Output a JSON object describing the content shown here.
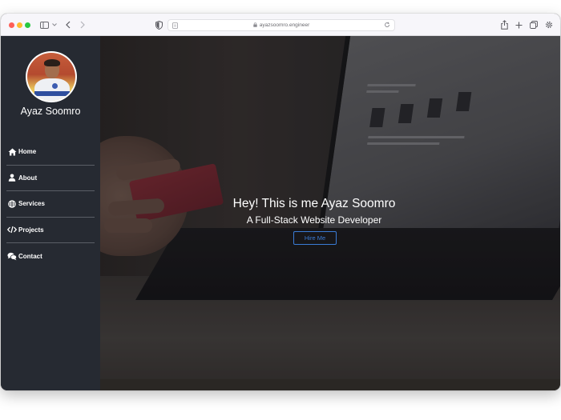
{
  "browser": {
    "url": "ayazsoomro.engineer",
    "colors": {
      "close": "#fe5f57",
      "minimize": "#febc2e",
      "maximize": "#28c840"
    },
    "icons": [
      "sidebar-icon",
      "chevron-down-icon",
      "back-icon",
      "forward-icon",
      "shield-icon",
      "page-icon",
      "lock-icon",
      "reload-icon",
      "share-icon",
      "plus-icon",
      "tabs-icon",
      "settings-icon"
    ]
  },
  "sidebar": {
    "name": "Ayaz Soomro",
    "items": [
      {
        "label": "Home",
        "icon": "home-icon"
      },
      {
        "label": "About",
        "icon": "user-icon"
      },
      {
        "label": "Services",
        "icon": "globe-icon"
      },
      {
        "label": "Projects",
        "icon": "code-icon"
      },
      {
        "label": "Contact",
        "icon": "chat-icon"
      }
    ]
  },
  "hero": {
    "title": "Hey! This is me Ayaz Soomro",
    "subtitle": "A Full-Stack Website Developer",
    "button": "Hire Me",
    "accent": "#3a7bd5"
  }
}
